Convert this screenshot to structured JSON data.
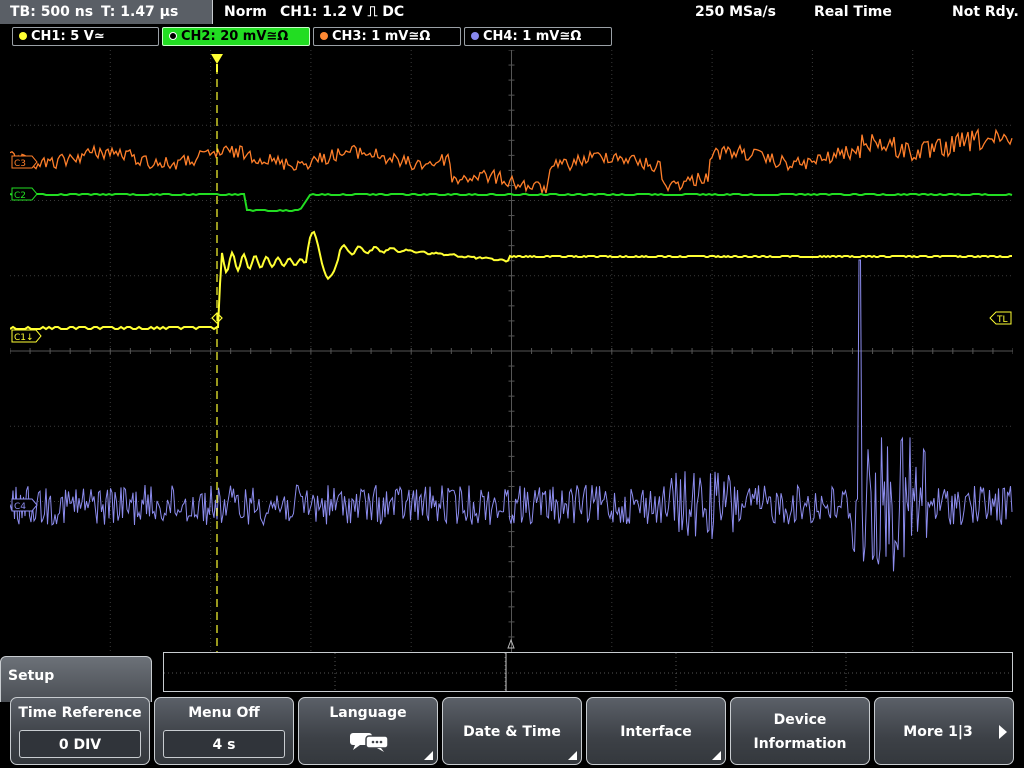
{
  "status": {
    "timebase": "TB: 500 ns",
    "trigger_time": "T: 1.47 µs",
    "mode": "Norm",
    "trigger_info": "CH1: 1.2 V ⎍ DC",
    "sample_rate": "250 MSa/s",
    "acq_mode": "Real Time",
    "state": "Not Rdy."
  },
  "channels": [
    {
      "label": "CH1: 5 V≃",
      "color": "#ffff33",
      "active": false
    },
    {
      "label": "CH2: 20 mV≅Ω",
      "color": "#22dd22",
      "active": true
    },
    {
      "label": "CH3: 1 mV≅Ω",
      "color": "#ff8833",
      "active": false
    },
    {
      "label": "CH4: 1 mV≅Ω",
      "color": "#8888ee",
      "active": false
    }
  ],
  "plot": {
    "markers": {
      "c1": "C1↓",
      "c2": "C2",
      "c3": "C3",
      "c4": "C4",
      "tl": "TL"
    },
    "colors": {
      "ch1": "#ffff33",
      "ch2": "#22dd22",
      "ch3": "#ff7f2a",
      "ch4": "#8c8cee",
      "grid": "#3a3a3a",
      "trigger": "#ffff33"
    }
  },
  "menu": {
    "title": "Setup",
    "time_reference": {
      "label": "Time Reference",
      "value": "0 DIV"
    },
    "menu_off": {
      "label": "Menu Off",
      "value": "4 s"
    },
    "language": {
      "label": "Language",
      "icon": "language-icon"
    },
    "date_time": {
      "label": "Date & Time"
    },
    "interface": {
      "label": "Interface"
    },
    "device_information": {
      "line1": "Device",
      "line2": "Information"
    },
    "more": {
      "label": "More 1|3"
    }
  }
}
